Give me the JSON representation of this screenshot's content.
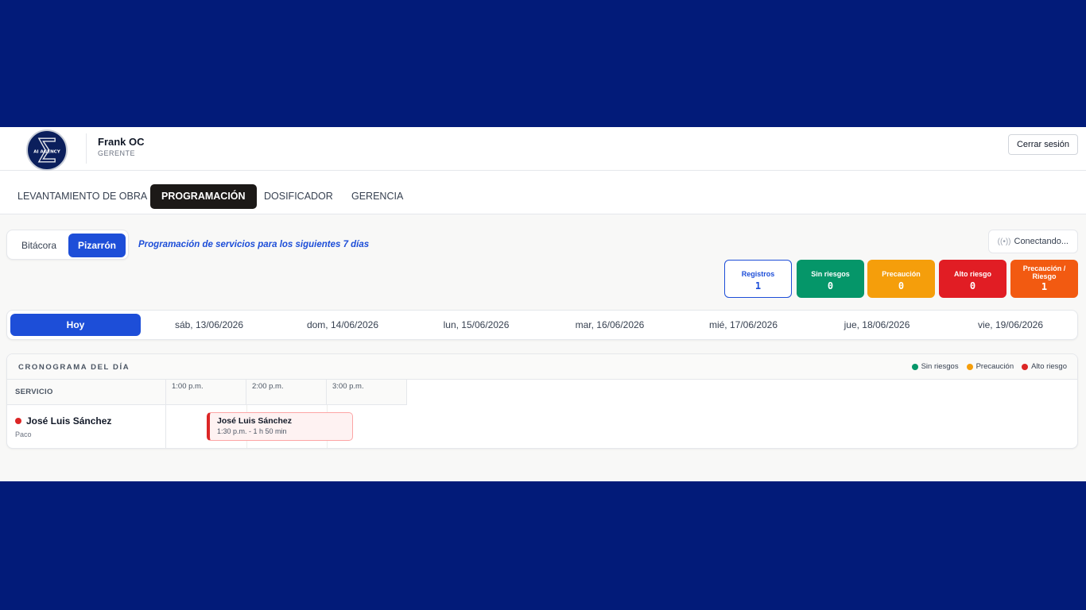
{
  "header": {
    "logo_text": "AI AGENCY",
    "user_name": "Frank OC",
    "user_role": "GERENTE",
    "logout_label": "Cerrar sesión"
  },
  "nav": {
    "tabs": [
      {
        "label": "LEVANTAMIENTO DE OBRA",
        "active": false
      },
      {
        "label": "PROGRAMACIÓN",
        "active": true
      },
      {
        "label": "DOSIFICADOR",
        "active": false
      },
      {
        "label": "GERENCIA",
        "active": false
      }
    ]
  },
  "view_toggle": {
    "options": [
      "Bitácora",
      "Pizarrón"
    ],
    "selected": "Pizarrón"
  },
  "subtitle": "Programación de servicios para los siguientes 7 días",
  "connection_status": "Conectando...",
  "stats": [
    {
      "label": "Registros",
      "value": "1",
      "color": "#1d4ed8"
    },
    {
      "label": "Sin riesgos",
      "value": "0",
      "color": "#059669"
    },
    {
      "label": "Precaución",
      "value": "0",
      "color": "#f59e0b"
    },
    {
      "label": "Alto riesgo",
      "value": "0",
      "color": "#e11d24"
    },
    {
      "label": "Precaución / Riesgo",
      "value": "1",
      "color": "#f25a11"
    }
  ],
  "days": [
    {
      "label": "Hoy",
      "active": true
    },
    {
      "label": "sáb, 13/06/2026",
      "active": false
    },
    {
      "label": "dom, 14/06/2026",
      "active": false
    },
    {
      "label": "lun, 15/06/2026",
      "active": false
    },
    {
      "label": "mar, 16/06/2026",
      "active": false
    },
    {
      "label": "mié, 17/06/2026",
      "active": false
    },
    {
      "label": "jue, 18/06/2026",
      "active": false
    },
    {
      "label": "vie, 19/06/2026",
      "active": false
    }
  ],
  "schedule": {
    "title": "CRONOGRAMA DEL DÍA",
    "legend": [
      {
        "label": "Sin riesgos",
        "color": "#059669"
      },
      {
        "label": "Precaución",
        "color": "#f59e0b"
      },
      {
        "label": "Alto riesgo",
        "color": "#dc2626"
      }
    ],
    "column_header": "SERVICIO",
    "times": [
      "1:00 p.m.",
      "2:00 p.m.",
      "3:00 p.m."
    ],
    "rows": [
      {
        "name": "José Luis Sánchez",
        "sub": "Paco",
        "status_color": "#dc2626",
        "event": {
          "title": "José Luis Sánchez",
          "detail": "1:30 p.m. - 1 h 50 min"
        }
      }
    ]
  }
}
